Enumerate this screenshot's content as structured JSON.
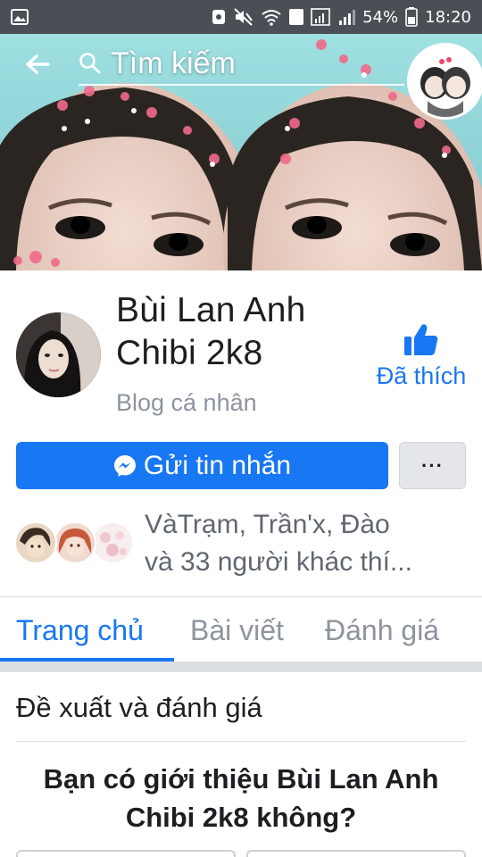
{
  "status_bar": {
    "battery": "54%",
    "time": "18:20",
    "sim_badge": "1"
  },
  "header": {
    "search_placeholder": "Tìm kiếm"
  },
  "page": {
    "name_line1": "Bùi Lan Anh",
    "name_line2": "Chibi 2k8",
    "category": "Blog cá nhân",
    "like_label": "Đã thích"
  },
  "actions": {
    "message_label": "Gửi tin nhắn",
    "more_label": "···"
  },
  "friends": {
    "line1": "VàTrạm, Trần'x, Đào",
    "line2": "và 33 người khác thí..."
  },
  "tabs": [
    {
      "label": "Trang chủ",
      "active": true
    },
    {
      "label": "Bài viết",
      "active": false
    },
    {
      "label": "Đánh giá",
      "active": false
    }
  ],
  "recommendations": {
    "title": "Đề xuất và đánh giá",
    "question": "Bạn có giới thiệu Bùi Lan Anh Chibi 2k8 không?"
  },
  "colors": {
    "accent": "#1877f2",
    "status_bar": "#4a4f55"
  }
}
